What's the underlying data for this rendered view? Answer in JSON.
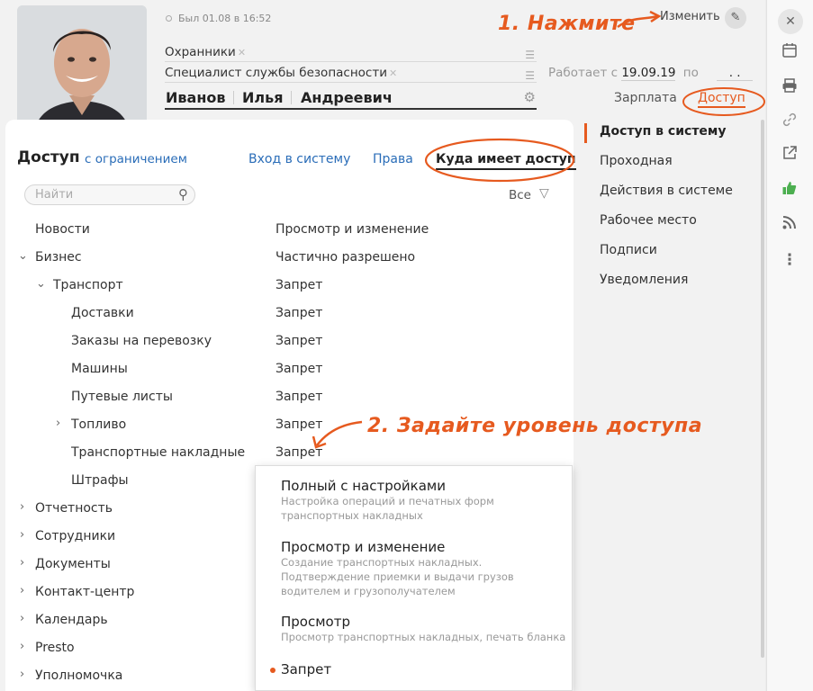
{
  "profile": {
    "last_seen": "Был 01.08 в 16:52",
    "field_group": "Охранники",
    "field_position": "Специалист службы безопасности",
    "last_name": "Иванов",
    "first_name": "Илья",
    "middle_name": "Андреевич",
    "works_since_label": "Работает с",
    "works_since_date": "19.09.19",
    "works_till_label": "по",
    "works_till_date": ". .",
    "edit_label": "Изменить",
    "tab_salary": "Зарплата",
    "tab_access": "Доступ"
  },
  "annotations": {
    "step1": "1. Нажмите",
    "step2": "2. Задайте уровень доступа"
  },
  "access": {
    "title": "Доступ",
    "subtitle": "с ограничением",
    "tabs": [
      "Вход в систему",
      "Права",
      "Куда имеет доступ"
    ],
    "search_placeholder": "Найти",
    "filter_label": "Все",
    "rows": [
      {
        "label": "Новости",
        "value": "Просмотр и изменение"
      },
      {
        "label": "Бизнес",
        "value": "Частично разрешено"
      },
      {
        "label": "Транспорт",
        "value": "Запрет"
      },
      {
        "label": "Доставки",
        "value": "Запрет"
      },
      {
        "label": "Заказы на перевозку",
        "value": "Запрет"
      },
      {
        "label": "Машины",
        "value": "Запрет"
      },
      {
        "label": "Путевые листы",
        "value": "Запрет"
      },
      {
        "label": "Топливо",
        "value": "Запрет"
      },
      {
        "label": "Транспортные накладные",
        "value": "Запрет"
      },
      {
        "label": "Штрафы",
        "value": ""
      },
      {
        "label": "Отчетность",
        "value": ""
      },
      {
        "label": "Сотрудники",
        "value": ""
      },
      {
        "label": "Документы",
        "value": ""
      },
      {
        "label": "Контакт-центр",
        "value": ""
      },
      {
        "label": "Календарь",
        "value": ""
      },
      {
        "label": "Presto",
        "value": ""
      },
      {
        "label": "Уполномочка",
        "value": ""
      }
    ]
  },
  "dropdown": {
    "options": [
      {
        "title": "Полный с настройками",
        "desc": [
          "Настройка операций и печатных форм",
          "транспортных накладных"
        ]
      },
      {
        "title": "Просмотр и изменение",
        "desc": [
          "Создание транспортных накладных.",
          "Подтверждение приемки и выдачи грузов",
          "водителем и грузополучателем"
        ]
      },
      {
        "title": "Просмотр",
        "desc": [
          "Просмотр транспортных накладных, печать бланка"
        ]
      },
      {
        "title": "Запрет",
        "desc": []
      }
    ],
    "selected": "Запрет"
  },
  "sidebar": {
    "items": [
      "Доступ в систему",
      "Проходная",
      "Действия в системе",
      "Рабочее место",
      "Подписи",
      "Уведомления"
    ]
  },
  "colors": {
    "accent": "#e65a1f",
    "link": "#2a6db8"
  },
  "rail_icons": [
    "close-icon",
    "calendar-icon",
    "printer-icon",
    "link-icon",
    "open-external-icon",
    "thumbs-up-icon",
    "rss-icon",
    "more-vertical-icon"
  ]
}
